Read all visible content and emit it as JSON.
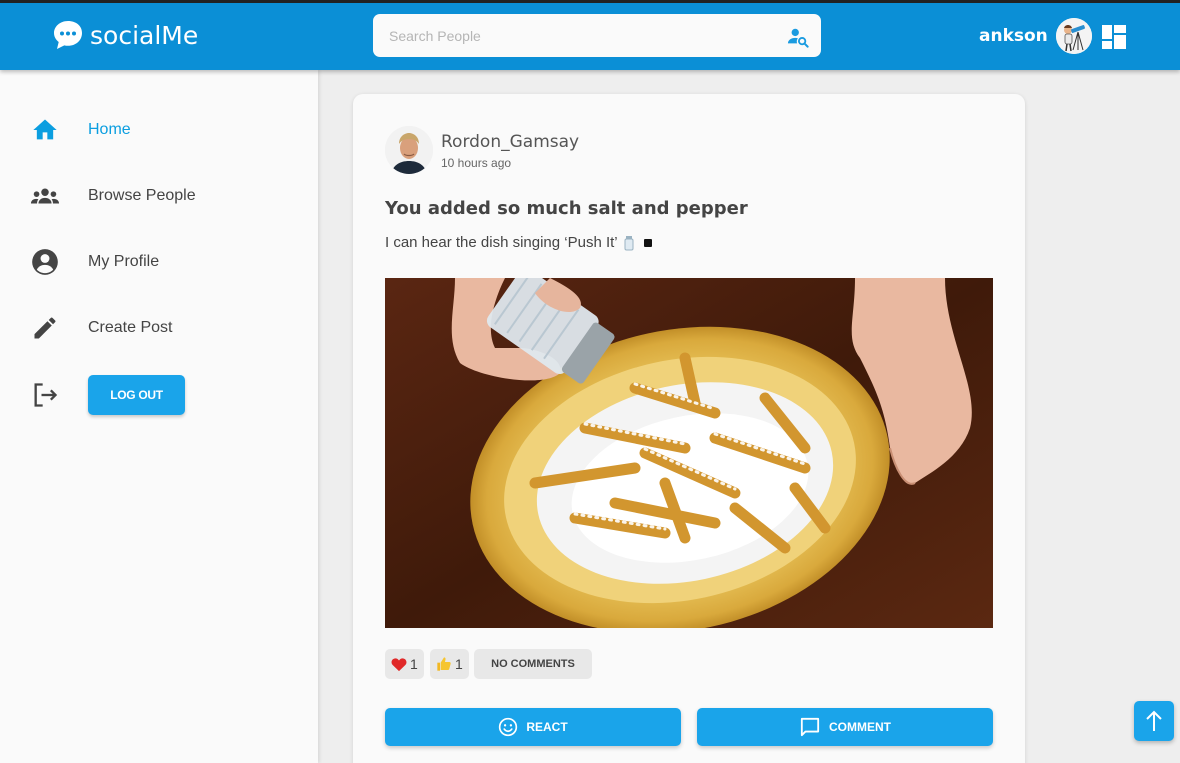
{
  "header": {
    "app_name": "socialMe",
    "search_placeholder": "Search People",
    "username": "ankson"
  },
  "sidebar": {
    "items": [
      {
        "label": "Home",
        "icon": "home-icon",
        "active": true
      },
      {
        "label": "Browse People",
        "icon": "people-icon",
        "active": false
      },
      {
        "label": "My Profile",
        "icon": "account-circle-icon",
        "active": false
      },
      {
        "label": "Create Post",
        "icon": "pencil-icon",
        "active": false
      }
    ],
    "logout_label": "LOG OUT"
  },
  "post": {
    "author": "Rordon_Gamsay",
    "time": "10 hours ago",
    "title": "You added so much salt and pepper",
    "body": "I can hear the dish singing ‘Push It’",
    "reactions": [
      {
        "icon": "heart-icon",
        "count": "1"
      },
      {
        "icon": "thumbs-up-icon",
        "count": "1"
      }
    ],
    "comments_label": "NO COMMENTS",
    "react_label": "REACT",
    "comment_label": "COMMENT"
  },
  "colors": {
    "primary": "#0b8fd6",
    "button": "#1aa4ea",
    "active_nav": "#0b9ee0"
  }
}
